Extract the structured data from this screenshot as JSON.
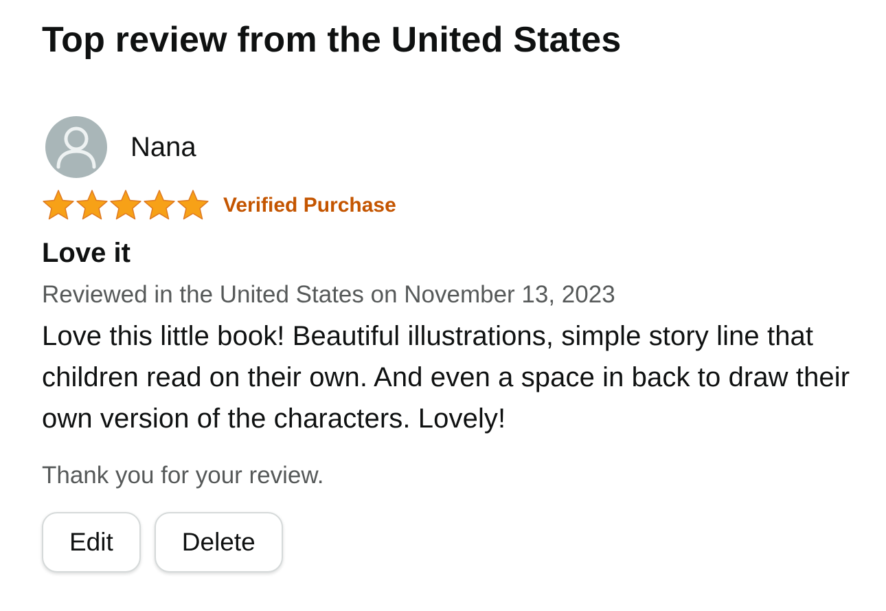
{
  "section": {
    "title": "Top review from the United States"
  },
  "review": {
    "reviewer": {
      "name": "Nana",
      "avatar_icon": "user-silhouette-icon"
    },
    "rating": 5,
    "rating_max": 5,
    "star_icon": "star-icon",
    "badge": "Verified Purchase",
    "title": "Love it",
    "date_line": "Reviewed in the United States on November 13, 2023",
    "body": "Love this little book! Beautiful illustrations, simple story line that children read on their own. And even a space in back to draw their own version of the characters. Lovely!",
    "thank_you": "Thank you for your review."
  },
  "actions": {
    "edit_label": "Edit",
    "delete_label": "Delete"
  },
  "colors": {
    "star": "#f7a117",
    "verified": "#c45500",
    "avatar_bg": "#a9b6b8",
    "secondary_text": "#565959"
  }
}
